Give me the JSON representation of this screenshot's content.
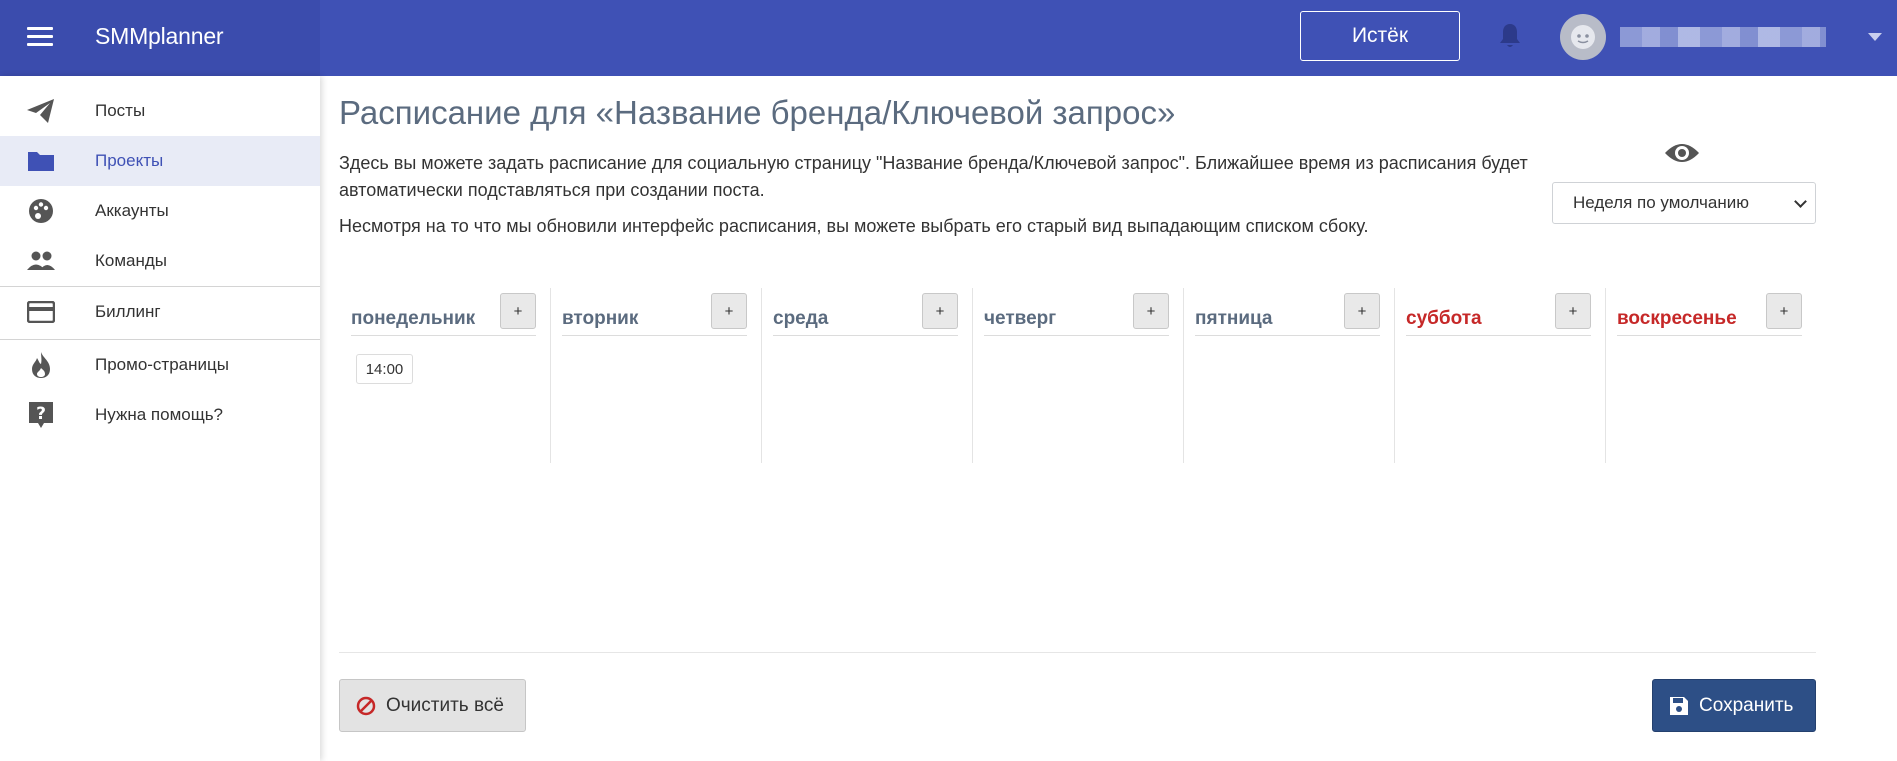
{
  "header": {
    "brand": "SMMplanner",
    "expired_button": "Истёк",
    "icons": {
      "menu": "hamburger-icon",
      "notifications": "bell-icon",
      "avatar": "avatar-icon",
      "user_menu": "chevron-down-icon"
    },
    "colors": {
      "bar": "#3f51b5",
      "brand_block": "#3b4cad"
    }
  },
  "sidebar": {
    "items": [
      {
        "label": "Посты",
        "icon": "paper-plane-icon",
        "active": false
      },
      {
        "label": "Проекты",
        "icon": "folder-icon",
        "active": true
      },
      {
        "label": "Аккаунты",
        "icon": "palette-icon",
        "active": false
      },
      {
        "label": "Команды",
        "icon": "people-icon",
        "active": false
      },
      {
        "label": "Биллинг",
        "icon": "credit-card-icon",
        "active": false
      },
      {
        "label": "Промо-страницы",
        "icon": "fire-icon",
        "active": false
      },
      {
        "label": "Нужна помощь?",
        "icon": "help-icon",
        "active": false
      }
    ]
  },
  "main": {
    "title": "Расписание для «Название бренда/Ключевой запрос»",
    "description_1": "Здесь вы можете задать расписание для социальную страницу \"Название бренда/Ключевой запрос\". Ближайшее время из расписания будет автоматически подставляться при создании поста.",
    "description_2": "Несмотря на то что мы обновили интерфейс расписания, вы можете выбрать его старый вид выпадающим списком сбоку.",
    "view_select": {
      "selected": "Неделя по умолчанию",
      "icon": "eye-icon"
    },
    "add_label": "+",
    "days": [
      {
        "name": "понедельник",
        "weekend": false,
        "times": [
          "14:00"
        ]
      },
      {
        "name": "вторник",
        "weekend": false,
        "times": []
      },
      {
        "name": "среда",
        "weekend": false,
        "times": []
      },
      {
        "name": "четверг",
        "weekend": false,
        "times": []
      },
      {
        "name": "пятница",
        "weekend": false,
        "times": []
      },
      {
        "name": "суббота",
        "weekend": true,
        "times": []
      },
      {
        "name": "воскресенье",
        "weekend": true,
        "times": []
      }
    ],
    "clear_button": "Очистить всё",
    "save_button": "Сохранить",
    "colors": {
      "weekend": "#c62828",
      "save": "#2d4f86",
      "active_nav": "#e8ebf6"
    }
  }
}
